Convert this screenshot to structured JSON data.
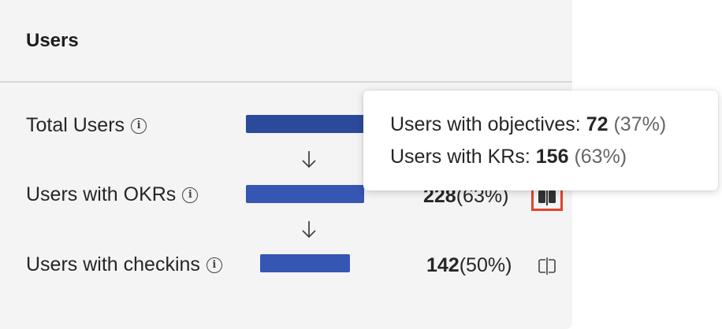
{
  "card": {
    "title": "Users"
  },
  "rows": [
    {
      "label": "Total Users",
      "bar_fraction": 1.0,
      "bar_color": "#2b4a9b",
      "count": "",
      "pct": ""
    },
    {
      "label": "Users with OKRs",
      "bar_fraction": 1.0,
      "bar_color": "#3556b3",
      "count": "228",
      "pct": "(63%)"
    },
    {
      "label": "Users with checkins",
      "bar_fraction": 0.76,
      "bar_color": "#3556b3",
      "count": "142",
      "pct": "(50%)"
    }
  ],
  "tooltip": {
    "line1_label": "Users with objectives:",
    "line1_value": "72",
    "line1_pct": "(37%)",
    "line2_label": "Users with KRs:",
    "line2_value": "156",
    "line2_pct": "(63%)"
  },
  "icons": {
    "info": "info-icon",
    "arrow": "arrow-down-icon",
    "split": "split-view-icon"
  },
  "colors": {
    "highlight": "#e2432a",
    "bar_primary": "#3556b3"
  }
}
